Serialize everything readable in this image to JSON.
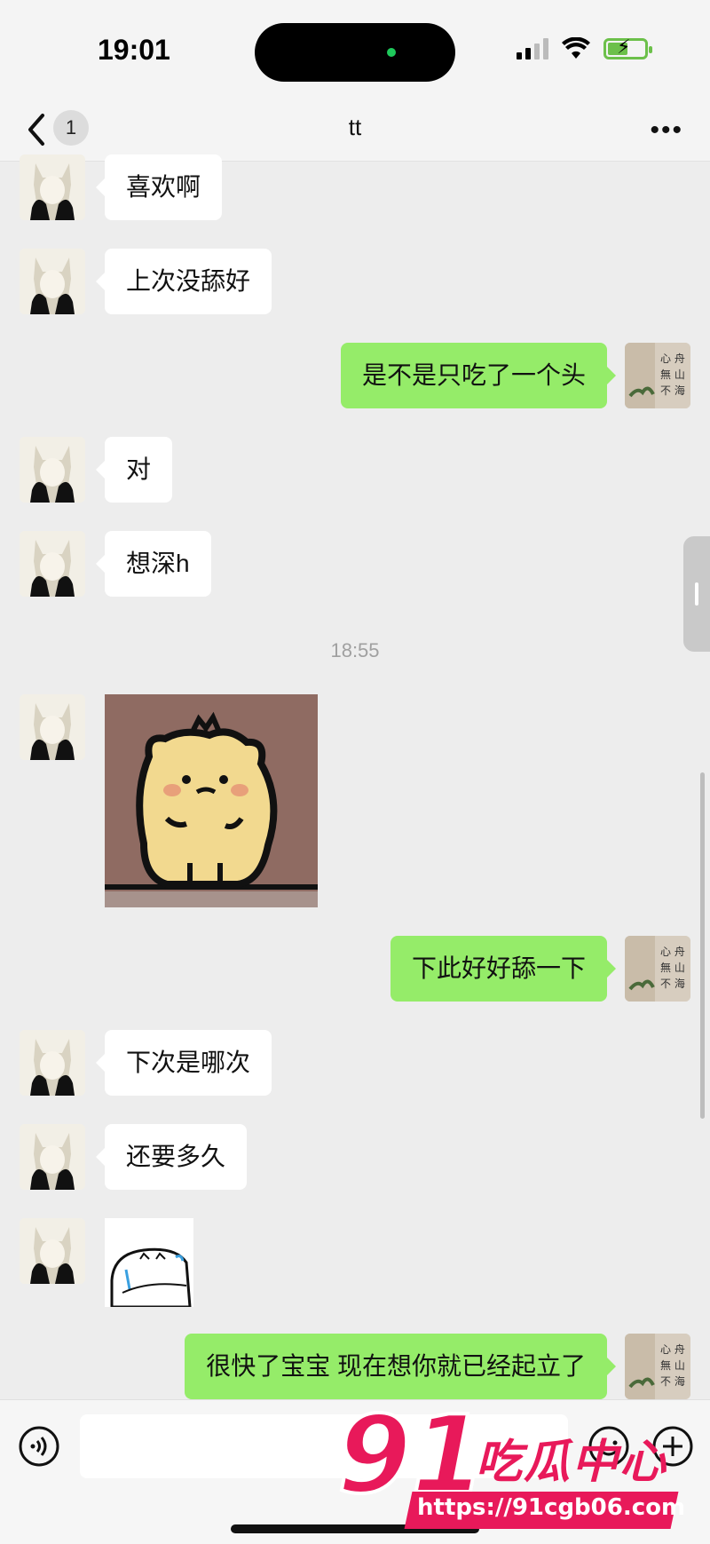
{
  "status_bar": {
    "time": "19:01"
  },
  "header": {
    "back_label": "",
    "unread_count": "1",
    "title": "tt"
  },
  "messages": [
    {
      "side": "left",
      "text": "喜欢啊"
    },
    {
      "side": "left",
      "text": "上次没舔好"
    },
    {
      "side": "right",
      "text": "是不是只吃了一个头"
    },
    {
      "side": "left",
      "text": "对"
    },
    {
      "side": "left",
      "text": "想深h"
    },
    {
      "side": "left",
      "type": "sticker",
      "icon": "bear-sticker"
    },
    {
      "side": "right",
      "text": "下此好好舔一下"
    },
    {
      "side": "left",
      "text": "下次是哪次"
    },
    {
      "side": "left",
      "text": "还要多久"
    },
    {
      "side": "left",
      "type": "sticker",
      "icon": "sleepy-cat-sticker"
    },
    {
      "side": "right",
      "text": "很快了宝宝 现在想你就已经起立了"
    }
  ],
  "timestamp": "18:55",
  "watermark": {
    "brand_number": "91",
    "brand_text": "吃瓜中心",
    "url": "https://91cgb06.com"
  },
  "colors": {
    "self_bubble": "#95ec69",
    "other_bubble": "#ffffff",
    "background": "#ededed",
    "watermark": "#e8195a"
  }
}
